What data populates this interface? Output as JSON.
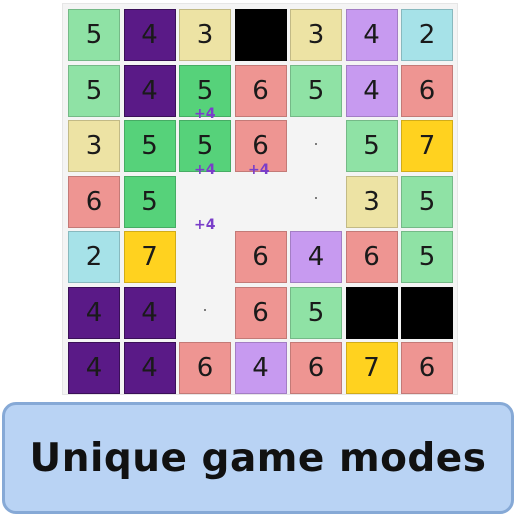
{
  "colors": {
    "c1": "#000000",
    "c2": "#a6e2e8",
    "c3": "#ede3a4",
    "c4": "#5a1a87",
    "c5": "#8fe2a5",
    "c5b": "#56d27a",
    "c6": "#ee9592",
    "c7": "#ffd21f",
    "c4l": "#c79af0"
  },
  "board": {
    "rows": [
      [
        {
          "v": "5",
          "c": "c5"
        },
        {
          "v": "4",
          "c": "c4"
        },
        {
          "v": "3",
          "c": "c3"
        },
        {
          "v": "",
          "c": "c1"
        },
        {
          "v": "3",
          "c": "c3"
        },
        {
          "v": "4",
          "c": "c4l"
        },
        {
          "v": "2",
          "c": "c2"
        }
      ],
      [
        {
          "v": "5",
          "c": "c5"
        },
        {
          "v": "4",
          "c": "c4"
        },
        {
          "v": "5",
          "c": "c5b"
        },
        {
          "v": "6",
          "c": "c6"
        },
        {
          "v": "5",
          "c": "c5"
        },
        {
          "v": "4",
          "c": "c4l"
        },
        {
          "v": "6",
          "c": "c6"
        }
      ],
      [
        {
          "v": "3",
          "c": "c3"
        },
        {
          "v": "5",
          "c": "c5b"
        },
        {
          "v": "5",
          "c": "c5b"
        },
        {
          "v": "6",
          "c": "c6"
        },
        null,
        {
          "v": "5",
          "c": "c5"
        },
        {
          "v": "7",
          "c": "c7"
        }
      ],
      [
        {
          "v": "6",
          "c": "c6"
        },
        {
          "v": "5",
          "c": "c5b"
        },
        null,
        null,
        null,
        {
          "v": "3",
          "c": "c3"
        },
        {
          "v": "5",
          "c": "c5"
        }
      ],
      [
        {
          "v": "2",
          "c": "c2"
        },
        {
          "v": "7",
          "c": "c7"
        },
        null,
        {
          "v": "6",
          "c": "c6"
        },
        {
          "v": "4",
          "c": "c4l"
        },
        {
          "v": "6",
          "c": "c6"
        },
        {
          "v": "5",
          "c": "c5"
        }
      ],
      [
        {
          "v": "4",
          "c": "c4"
        },
        {
          "v": "4",
          "c": "c4"
        },
        null,
        {
          "v": "6",
          "c": "c6"
        },
        {
          "v": "5",
          "c": "c5"
        },
        {
          "v": "",
          "c": "c1"
        },
        {
          "v": "",
          "c": "c1"
        }
      ],
      [
        {
          "v": "4",
          "c": "c4"
        },
        {
          "v": "4",
          "c": "c4"
        },
        {
          "v": "6",
          "c": "c6"
        },
        {
          "v": "4",
          "c": "c4l"
        },
        {
          "v": "6",
          "c": "c6"
        },
        {
          "v": "7",
          "c": "c7"
        },
        {
          "v": "6",
          "c": "c6"
        }
      ]
    ],
    "bonuses": [
      "+4",
      "+4",
      "+4",
      "+4"
    ]
  },
  "banner": {
    "text": "Unique game modes"
  }
}
